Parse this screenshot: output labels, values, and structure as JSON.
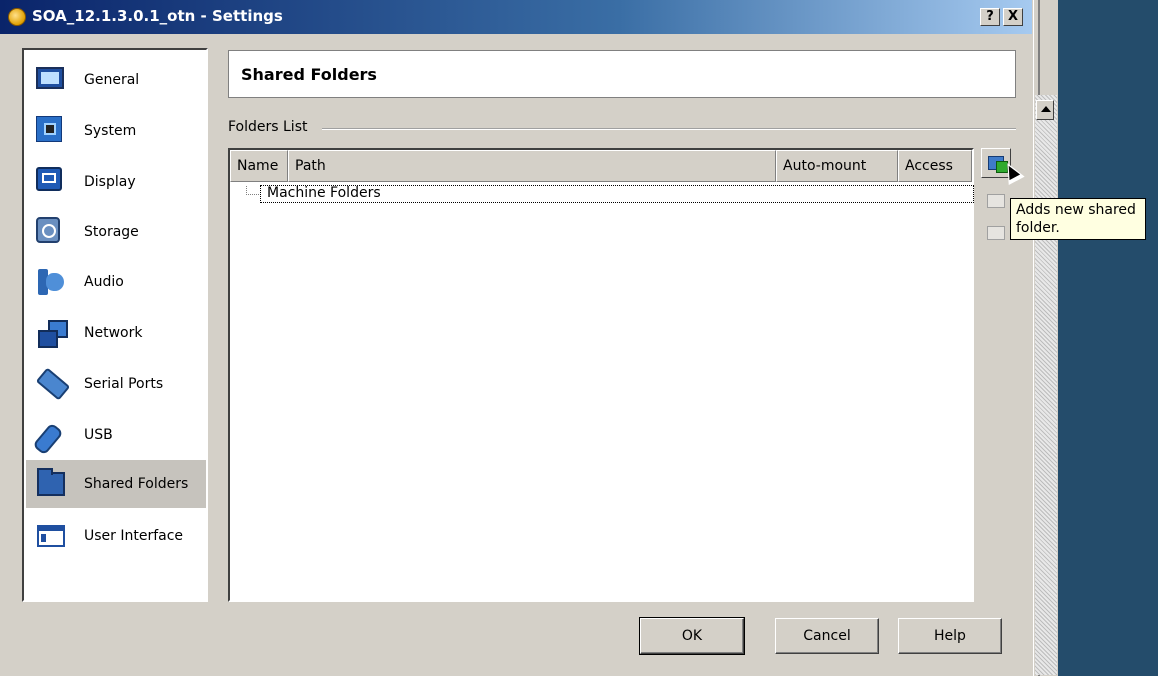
{
  "window": {
    "title": "SOA_12.1.3.0.1_otn - Settings",
    "help_button": "?",
    "close_button": "X"
  },
  "sidebar": {
    "items": [
      {
        "label": "General",
        "icon": "general-icon"
      },
      {
        "label": "System",
        "icon": "system-icon"
      },
      {
        "label": "Display",
        "icon": "display-icon"
      },
      {
        "label": "Storage",
        "icon": "storage-icon"
      },
      {
        "label": "Audio",
        "icon": "audio-icon"
      },
      {
        "label": "Network",
        "icon": "network-icon"
      },
      {
        "label": "Serial Ports",
        "icon": "serial-ports-icon"
      },
      {
        "label": "USB",
        "icon": "usb-icon"
      },
      {
        "label": "Shared Folders",
        "icon": "shared-folders-icon",
        "selected": true
      },
      {
        "label": "User Interface",
        "icon": "user-interface-icon"
      }
    ]
  },
  "page": {
    "title": "Shared Folders",
    "group_label": "Folders List"
  },
  "folders_list": {
    "columns": [
      "Name",
      "Path",
      "Auto-mount",
      "Access"
    ],
    "rows": [
      {
        "name": "Machine Folders"
      }
    ]
  },
  "tools": {
    "add_tooltip": "Adds new shared folder."
  },
  "buttons": {
    "ok": "OK",
    "cancel": "Cancel",
    "help": "Help"
  }
}
